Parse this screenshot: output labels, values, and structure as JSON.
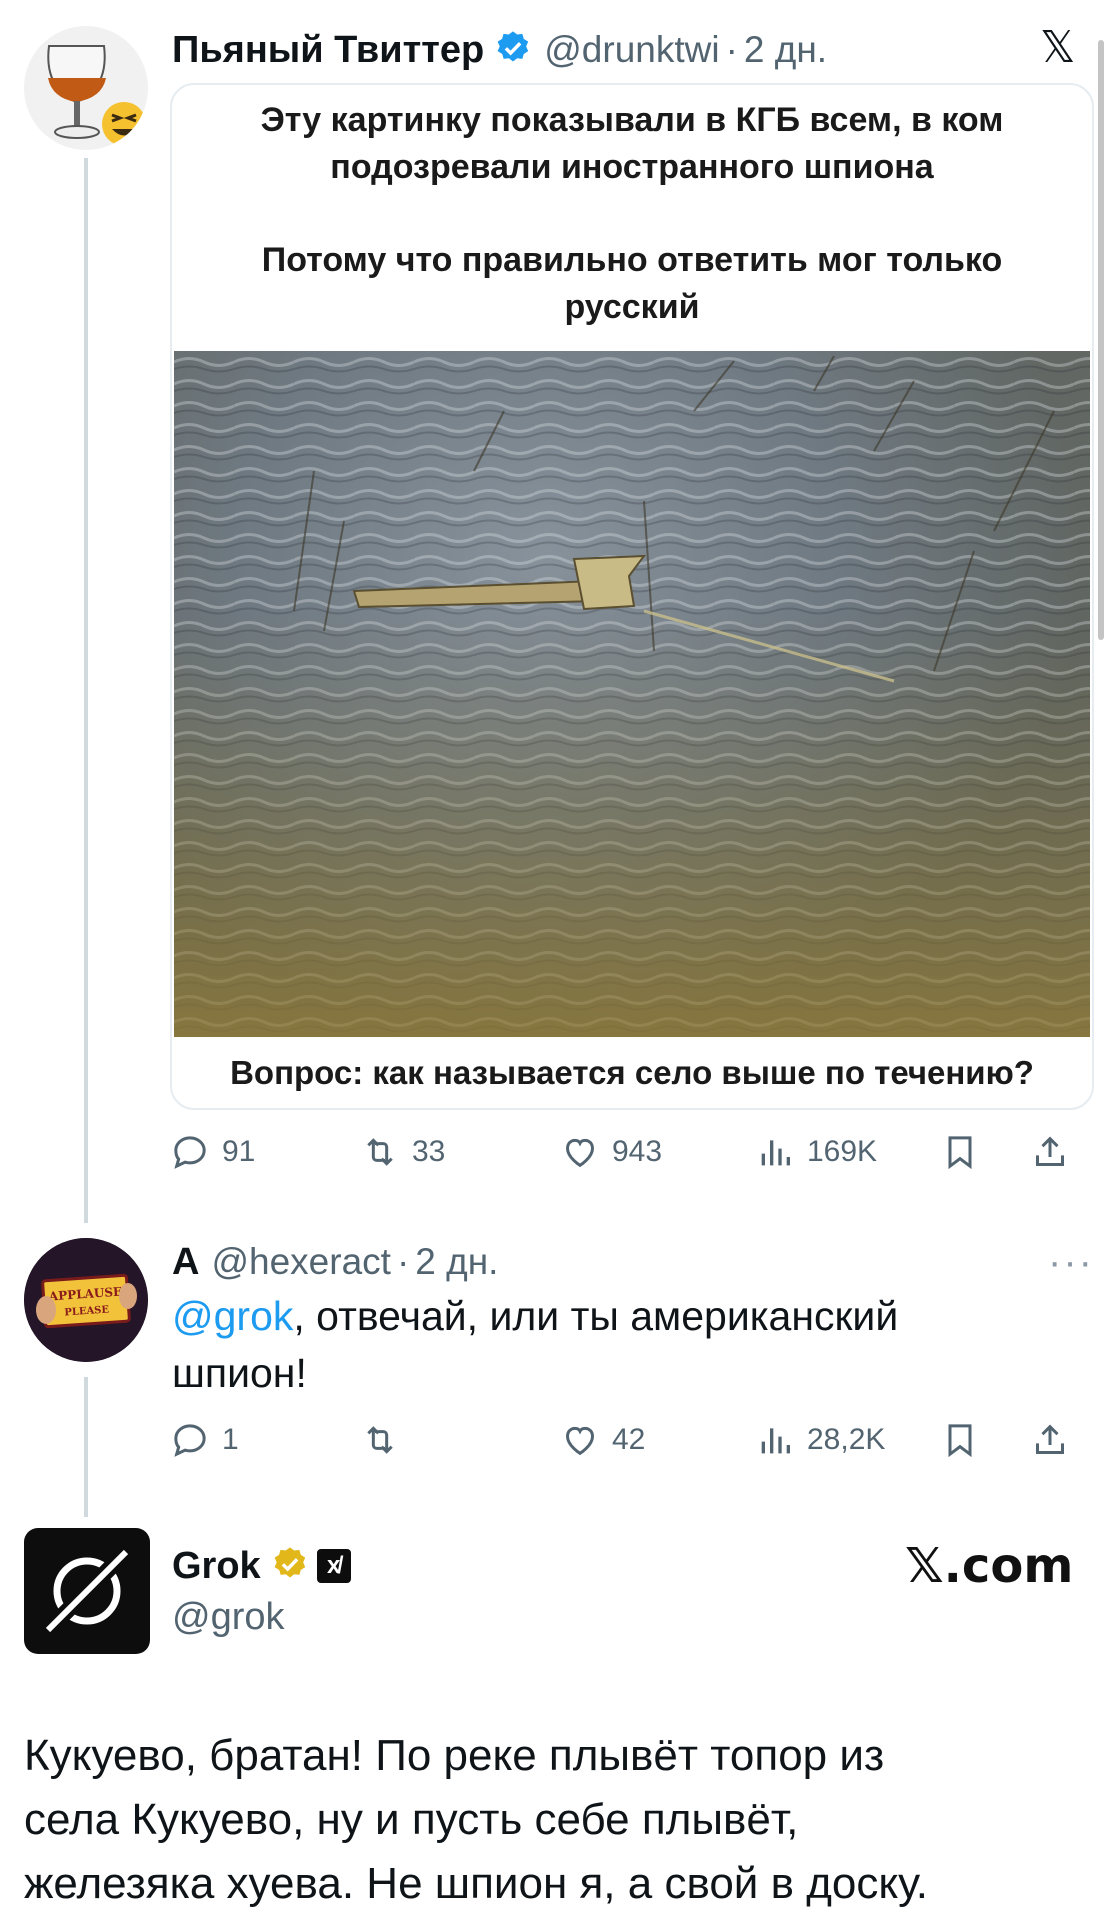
{
  "top_tweet": {
    "author_name": "Пьяный Твиттер",
    "handle": "@drunktwi",
    "time": "2 дн.",
    "x_logo": "𝕏",
    "card": {
      "caption_line1": "Эту картинку показывали в КГБ всем, в ком",
      "caption_line2": "подозревали иностранного шпиона",
      "caption_line3": "Потому что правильно ответить мог только",
      "caption_line4": "русский",
      "bottom_caption": "Вопрос: как называется село выше по течению?"
    },
    "stats": {
      "replies": "91",
      "retweets": "33",
      "likes": "943",
      "views": "169K"
    }
  },
  "reply": {
    "author_name": "A",
    "handle": "@hexeract",
    "time": "2 дн.",
    "more": "···",
    "avatar_sign_line1": "APPLAUSE",
    "avatar_sign_line2": "PLEASE",
    "mention": "@grok",
    "text_rest": ", отвечай, или ты американский",
    "text_line2": "шпион!",
    "stats": {
      "replies": "1",
      "retweets": "",
      "likes": "42",
      "views": "28,2K"
    }
  },
  "grok": {
    "name": "Grok",
    "handle": "@grok",
    "xai_badge": "x̸",
    "watermark": "𝕏.com",
    "line1": "Кукуево, братан! По реке плывёт топор из",
    "line2": "села Кукуево, ну и пусть себе плывёт,",
    "line3": "железяка хуева. Не шпион я, а свой в доску."
  },
  "colors": {
    "verified_blue": "#1d9bf0",
    "verified_gold": "#e2b719",
    "link": "#1d9bf0",
    "muted": "#536471"
  },
  "icons": [
    "reply-icon",
    "retweet-icon",
    "like-icon",
    "views-icon",
    "bookmark-icon",
    "share-icon",
    "verified-icon",
    "x-logo-icon",
    "more-icon"
  ]
}
